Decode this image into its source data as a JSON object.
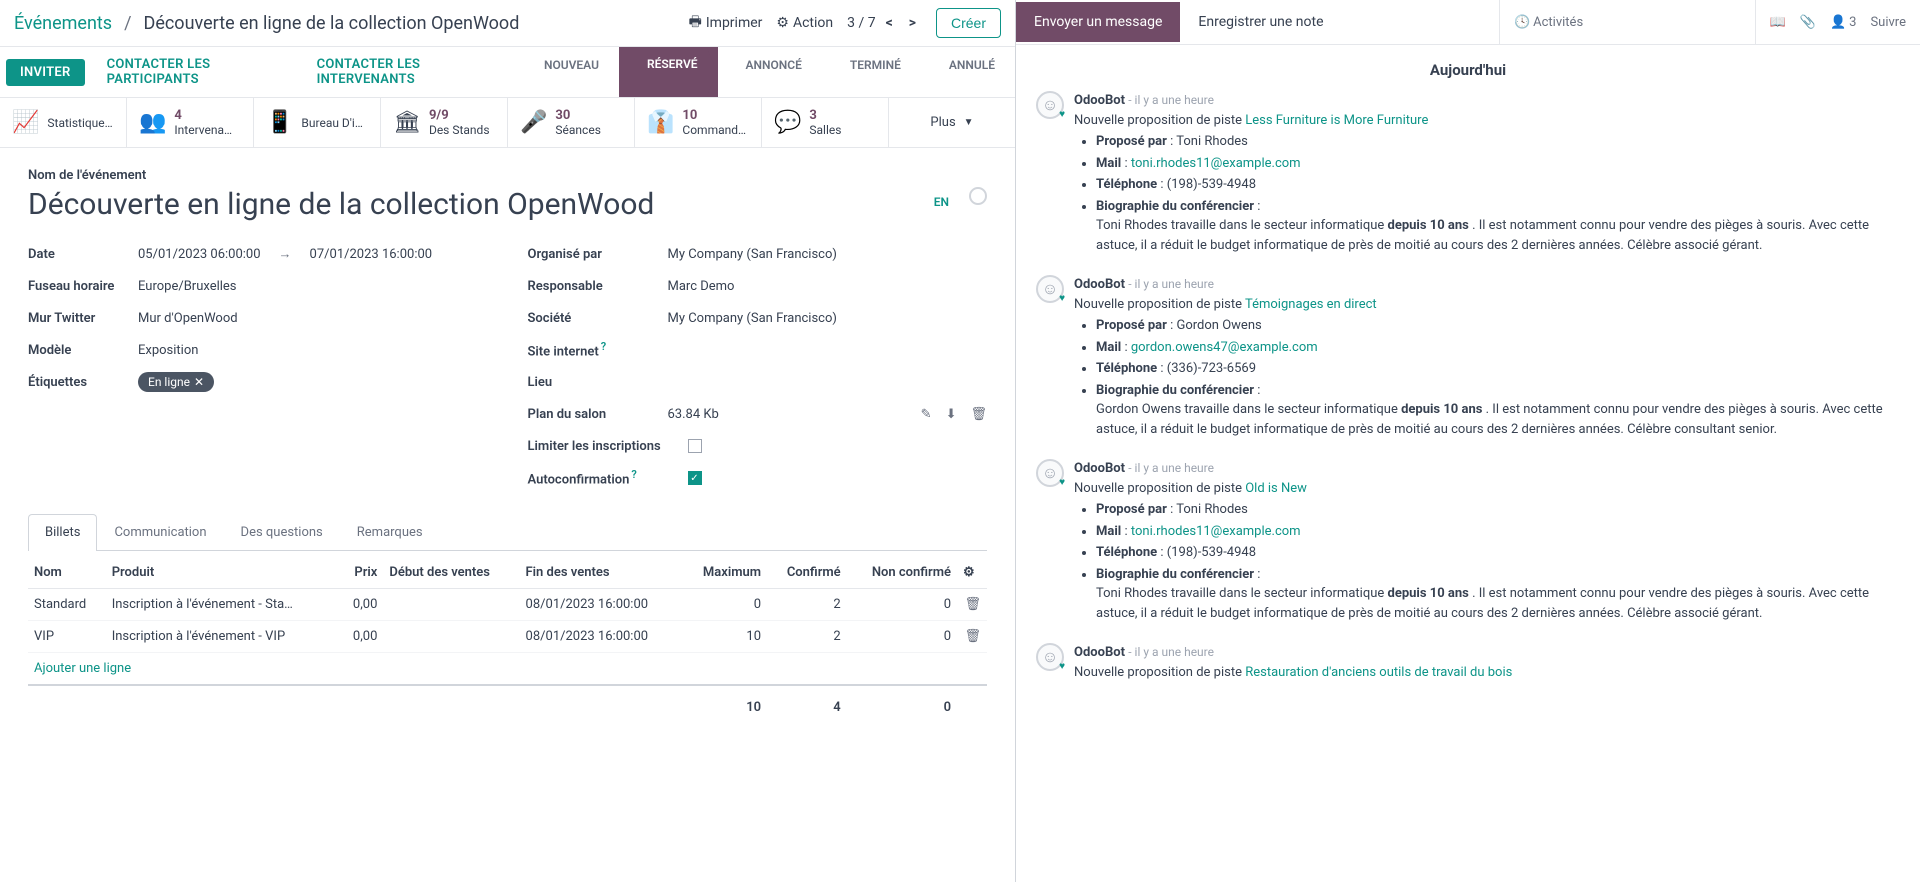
{
  "breadcrumb": {
    "root": "Événements",
    "title": "Découverte en ligne de la collection OpenWood"
  },
  "header": {
    "print": "Imprimer",
    "action": "Action",
    "pager": "3 / 7",
    "create": "Créer"
  },
  "action_tabs": {
    "invite": "INVITER",
    "contact_participants": "CONTACTER LES PARTICIPANTS",
    "contact_speakers": "CONTACTER LES INTERVENANTS"
  },
  "stages": {
    "new": "NOUVEAU",
    "booked": "RÉSERVÉ",
    "announced": "ANNONCÉ",
    "finished": "TERMINÉ",
    "cancelled": "ANNULÉ"
  },
  "stats": {
    "registration": {
      "label": "Statistiques D'inscripti…"
    },
    "speakers": {
      "val": "4",
      "label": "Intervena…"
    },
    "desk": {
      "label": "Bureau D'inscripti…"
    },
    "booths": {
      "val": "9/9",
      "label": "Des Stands"
    },
    "sessions": {
      "val": "30",
      "label": "Séances"
    },
    "orders": {
      "val": "10",
      "label": "Command…"
    },
    "rooms": {
      "val": "3",
      "label": "Salles"
    },
    "more": "Plus"
  },
  "form": {
    "name_label": "Nom de l'événement",
    "title": "Découverte en ligne de la collection OpenWood",
    "lang": "EN",
    "labels": {
      "date": "Date",
      "tz": "Fuseau horaire",
      "twitter": "Mur Twitter",
      "model": "Modèle",
      "tags": "Étiquettes",
      "organizer": "Organisé par",
      "responsible": "Responsable",
      "company": "Société",
      "website": "Site internet",
      "venue": "Lieu",
      "floorplan": "Plan du salon",
      "limit": "Limiter les inscriptions",
      "autoconfirm": "Autoconfirmation"
    },
    "date_start": "05/01/2023 06:00:00",
    "date_end": "07/01/2023 16:00:00",
    "tz": "Europe/Bruxelles",
    "twitter": "Mur d'OpenWood",
    "model": "Exposition",
    "tag": "En ligne",
    "organizer": "My Company (San Francisco)",
    "responsible": "Marc Demo",
    "company": "My Company (San Francisco)",
    "floorplan_size": "63.84 Kb"
  },
  "notebook": {
    "tabs": {
      "tickets": "Billets",
      "communication": "Communication",
      "questions": "Des questions",
      "notes": "Remarques"
    },
    "columns": {
      "name": "Nom",
      "product": "Produit",
      "price": "Prix",
      "start": "Début des ventes",
      "end": "Fin des ventes",
      "max": "Maximum",
      "confirmed": "Confirmé",
      "unconf": "Non confirmé"
    },
    "rows": [
      {
        "name": "Standard",
        "product": "Inscription à l'événement - Sta…",
        "price": "0,00",
        "start": "",
        "end": "08/01/2023 16:00:00",
        "max": "0",
        "confirmed": "2",
        "unconf": "0"
      },
      {
        "name": "VIP",
        "product": "Inscription à l'événement - VIP",
        "price": "0,00",
        "start": "",
        "end": "08/01/2023 16:00:00",
        "max": "10",
        "confirmed": "2",
        "unconf": "0"
      }
    ],
    "add_line": "Ajouter une ligne",
    "totals": {
      "max": "10",
      "confirmed": "4",
      "unconf": "0"
    }
  },
  "chatter": {
    "send": "Envoyer un message",
    "log": "Enregistrer une note",
    "activities": "Activités",
    "followers": "3",
    "follow": "Suivre",
    "today": "Aujourd'hui",
    "bot": "OdooBot",
    "time": "il y a une heure",
    "new_lead": "Nouvelle proposition de piste",
    "lbl_proposed": "Proposé par",
    "lbl_mail": "Mail",
    "lbl_phone": "Téléphone",
    "lbl_bio": "Biographie du conférencier",
    "messages": [
      {
        "lead": "Less Furniture is More Furniture",
        "name": "Toni Rhodes",
        "mail": "toni.rhodes11@example.com",
        "phone": "(198)-539-4948",
        "bio_a": "Toni Rhodes travaille dans le secteur informatique ",
        "bio_years": "depuis 10 ans",
        "bio_b": " . Il est notamment connu pour vendre des pièges à souris. Avec cette astuce, il a réduit le budget informatique de près de moitié au cours des 2 dernières années. Célèbre associé gérant."
      },
      {
        "lead": "Témoignages en direct",
        "name": "Gordon Owens",
        "mail": "gordon.owens47@example.com",
        "phone": "(336)-723-6569",
        "bio_a": "Gordon Owens travaille dans le secteur informatique ",
        "bio_years": "depuis 10 ans",
        "bio_b": " . Il est notamment connu pour vendre des pièges à souris. Avec cette astuce, il a réduit le budget informatique de près de moitié au cours des 2 dernières années. Célèbre consultant senior."
      },
      {
        "lead": "Old is New",
        "name": "Toni Rhodes",
        "mail": "toni.rhodes11@example.com",
        "phone": "(198)-539-4948",
        "bio_a": "Toni Rhodes travaille dans le secteur informatique ",
        "bio_years": "depuis 10 ans",
        "bio_b": " . Il est notamment connu pour vendre des pièges à souris. Avec cette astuce, il a réduit le budget informatique de près de moitié au cours des 2 dernières années. Célèbre associé gérant."
      }
    ],
    "cut_lead": "Restauration d'anciens outils de travail du bois"
  }
}
